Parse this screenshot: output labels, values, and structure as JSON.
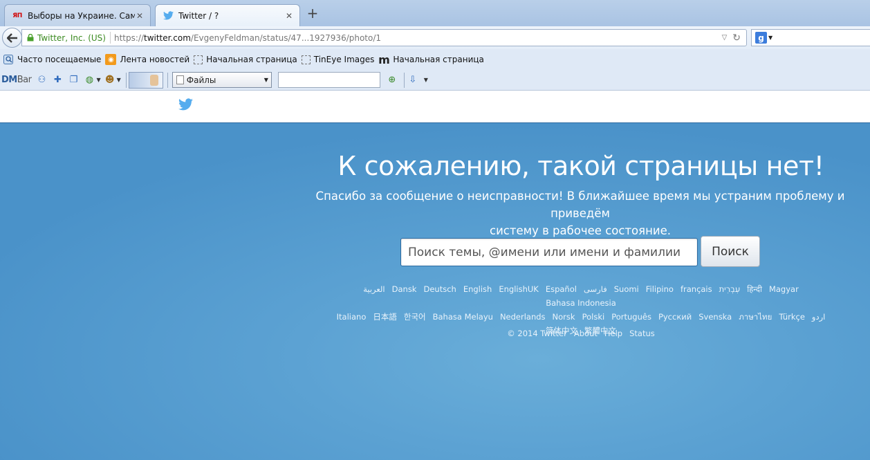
{
  "browser": {
    "tabs": [
      {
        "favicon": "ЯП",
        "title": "Выборы на Украине. Сам..."
      },
      {
        "favicon": "twitter-bird-icon",
        "title": "Twitter / ?"
      }
    ],
    "new_tab": "+",
    "identity": "Twitter, Inc. (US)",
    "url_prefix": "https://",
    "url_domain": "twitter.com",
    "url_path": "/EvgenyFeldman/status/47...1927936/photo/1",
    "search_engine_icon": "google-icon"
  },
  "bookmarks": [
    {
      "label": "Часто посещаемые",
      "icon": "frequent-icon"
    },
    {
      "label": "Лента новостей",
      "icon": "rss-icon"
    },
    {
      "label": "Начальная страница",
      "icon": "page-icon"
    },
    {
      "label": "TinEye Images",
      "icon": "page-icon"
    },
    {
      "label": "Начальная страница",
      "icon": "m-icon"
    }
  ],
  "dmbar": {
    "logo_dm": "DM",
    "logo_bar": "Bar",
    "select_value": "Файлы"
  },
  "page": {
    "title": "К сожалению, такой страницы нет!",
    "subtitle_line1": "Спасибо за сообщение о неисправности! В ближайшее время мы устраним проблему и приведём",
    "subtitle_line2": "систему в рабочее состояние.",
    "search_placeholder": "Поиск темы, @имени или имени и фамилии",
    "search_button": "Поиск",
    "languages_row1": [
      "العربية",
      "Dansk",
      "Deutsch",
      "English",
      "EnglishUK",
      "Español",
      "فارسی",
      "Suomi",
      "Filipino",
      "français",
      "עִבְרִית",
      "हिन्दी",
      "Magyar",
      "Bahasa Indonesia"
    ],
    "languages_row2": [
      "Italiano",
      "日本語",
      "한국어",
      "Bahasa Melayu",
      "Nederlands",
      "Norsk",
      "Polski",
      "Português",
      "Русский",
      "Svenska",
      "ภาษาไทย",
      "Türkçe",
      "اردو"
    ],
    "languages_row3": [
      "简体中文",
      "繁體中文"
    ],
    "footer": [
      "© 2014 Twitter",
      "About",
      "Help",
      "Status"
    ]
  },
  "colors": {
    "hero_bg": "#5ca2d3",
    "twitter_blue": "#55acee",
    "identity_green": "#3b8a20"
  }
}
